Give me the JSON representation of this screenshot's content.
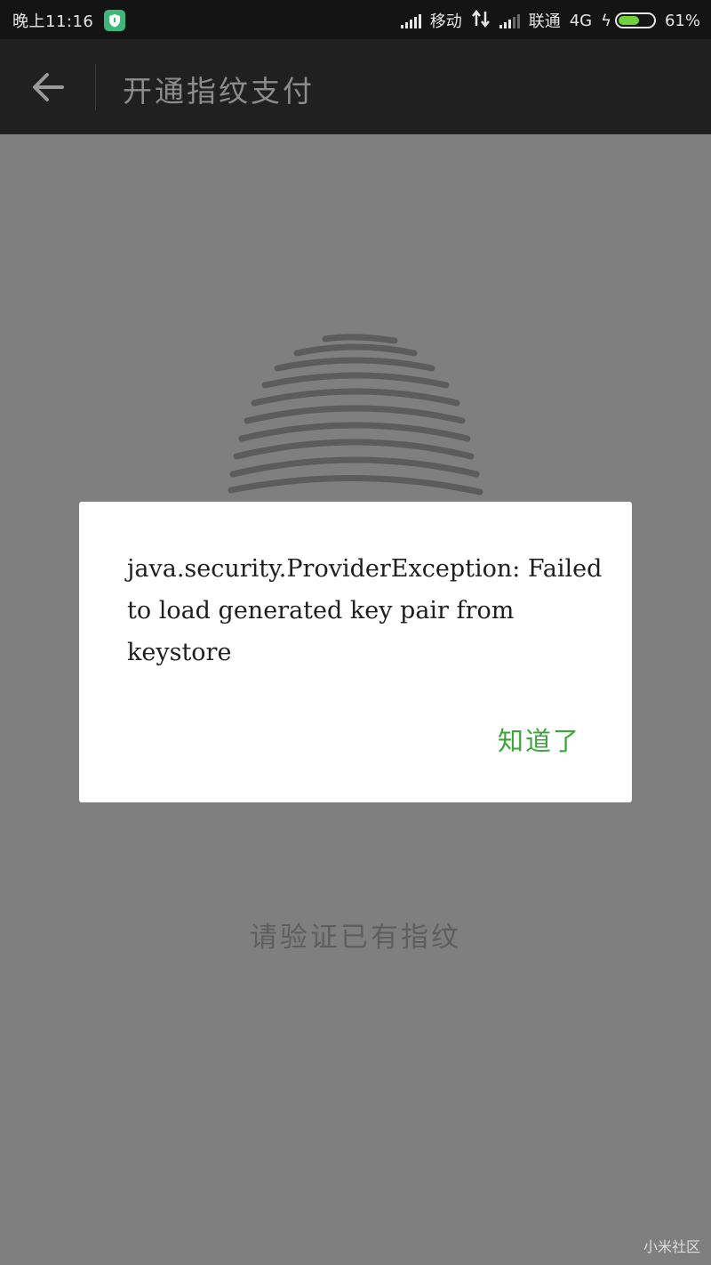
{
  "status_bar": {
    "time": "晚上11:16",
    "carrier1": "移动",
    "carrier2": "联通",
    "network": "4G",
    "battery_percent": "61%",
    "battery_level": 0.61,
    "shield_icon": "security-shield-icon"
  },
  "appbar": {
    "back_icon": "arrow-left-icon",
    "title": "开通指纹支付"
  },
  "main": {
    "fingerprint_icon": "fingerprint-icon",
    "verify_text": "请验证已有指纹"
  },
  "dialog": {
    "message": "java.security.ProviderException: Failed to load generated key pair from keystore",
    "ok_label": "知道了",
    "ok_color": "#3aa63a"
  },
  "watermark": "小米社区"
}
